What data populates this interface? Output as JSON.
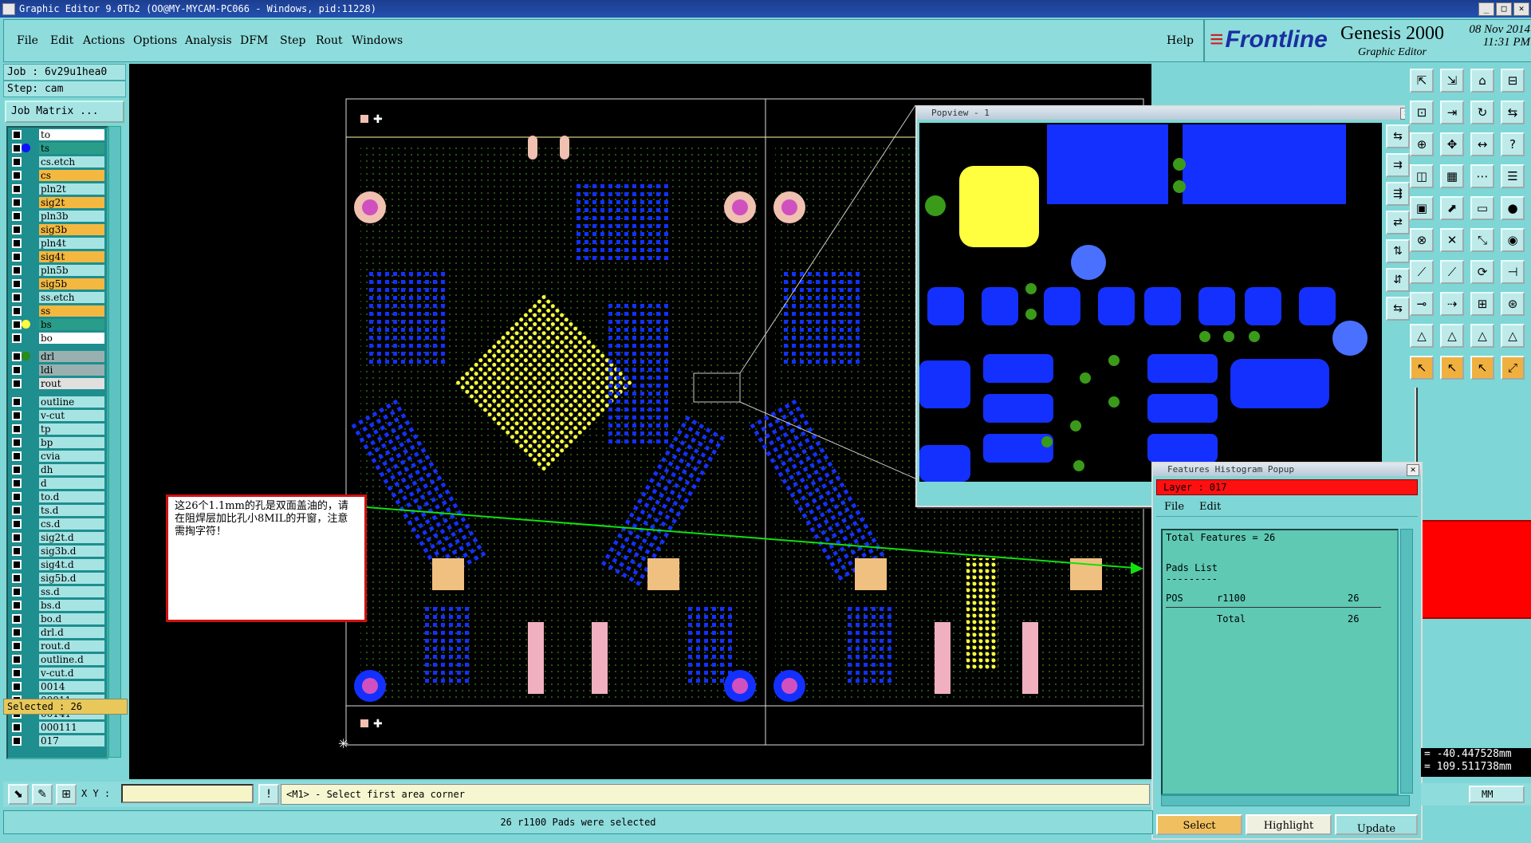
{
  "window": {
    "title": "Graphic Editor 9.0Tb2 (OO@MY-MYCAM-PC066 - Windows, pid:11228)",
    "controls": [
      "_",
      "□",
      "✕"
    ]
  },
  "menu": {
    "items": [
      "File",
      "Edit",
      "Actions",
      "Options",
      "Analysis",
      "DFM",
      "Step",
      "Rout",
      "Windows"
    ],
    "help": "Help"
  },
  "brand": {
    "logo": "Frontline",
    "product": "Genesis 2000",
    "subtitle": "Graphic Editor",
    "date": "08 Nov 2014",
    "time": "11:31 PM"
  },
  "job": {
    "job_label": "Job : 6v29u1hea0",
    "step_label": "Step: cam",
    "matrix_button": "Job Matrix ..."
  },
  "layers": [
    {
      "name": "to",
      "bg": "#ffffff",
      "dot": ""
    },
    {
      "name": "ts",
      "bg": "#2a9c8a",
      "dot": "#1010ff"
    },
    {
      "name": "cs.etch",
      "bg": "#a6e4e4",
      "dot": ""
    },
    {
      "name": "cs",
      "bg": "#f4b840",
      "dot": ""
    },
    {
      "name": "pln2t",
      "bg": "#a6e4e4",
      "dot": ""
    },
    {
      "name": "sig2t",
      "bg": "#f4b840",
      "dot": ""
    },
    {
      "name": "pln3b",
      "bg": "#a6e4e4",
      "dot": ""
    },
    {
      "name": "sig3b",
      "bg": "#f4b840",
      "dot": ""
    },
    {
      "name": "pln4t",
      "bg": "#a6e4e4",
      "dot": ""
    },
    {
      "name": "sig4t",
      "bg": "#f4b840",
      "dot": ""
    },
    {
      "name": "pln5b",
      "bg": "#a6e4e4",
      "dot": ""
    },
    {
      "name": "sig5b",
      "bg": "#f4b840",
      "dot": ""
    },
    {
      "name": "ss.etch",
      "bg": "#a6e4e4",
      "dot": ""
    },
    {
      "name": "ss",
      "bg": "#f4b840",
      "dot": ""
    },
    {
      "name": "bs",
      "bg": "#2a9c8a",
      "dot": "#ffff40"
    },
    {
      "name": "bo",
      "bg": "#ffffff",
      "dot": ""
    },
    {
      "name": "drl",
      "bg": "#9ab0b0",
      "dot": "#2a8a1a"
    },
    {
      "name": "ldi",
      "bg": "#9ab0b0",
      "dot": ""
    },
    {
      "name": "rout",
      "bg": "#e0e0e0",
      "dot": ""
    },
    {
      "name": "outline",
      "bg": "#a6e4e4",
      "dot": ""
    },
    {
      "name": "v-cut",
      "bg": "#a6e4e4",
      "dot": ""
    },
    {
      "name": "tp",
      "bg": "#a6e4e4",
      "dot": ""
    },
    {
      "name": "bp",
      "bg": "#a6e4e4",
      "dot": ""
    },
    {
      "name": "cvia",
      "bg": "#a6e4e4",
      "dot": ""
    },
    {
      "name": "dh",
      "bg": "#a6e4e4",
      "dot": ""
    },
    {
      "name": "d",
      "bg": "#a6e4e4",
      "dot": ""
    },
    {
      "name": "to.d",
      "bg": "#a6e4e4",
      "dot": ""
    },
    {
      "name": "ts.d",
      "bg": "#a6e4e4",
      "dot": ""
    },
    {
      "name": "cs.d",
      "bg": "#a6e4e4",
      "dot": ""
    },
    {
      "name": "sig2t.d",
      "bg": "#a6e4e4",
      "dot": ""
    },
    {
      "name": "sig3b.d",
      "bg": "#a6e4e4",
      "dot": ""
    },
    {
      "name": "sig4t.d",
      "bg": "#a6e4e4",
      "dot": ""
    },
    {
      "name": "sig5b.d",
      "bg": "#a6e4e4",
      "dot": ""
    },
    {
      "name": "ss.d",
      "bg": "#a6e4e4",
      "dot": ""
    },
    {
      "name": "bs.d",
      "bg": "#a6e4e4",
      "dot": ""
    },
    {
      "name": "bo.d",
      "bg": "#a6e4e4",
      "dot": ""
    },
    {
      "name": "drl.d",
      "bg": "#a6e4e4",
      "dot": ""
    },
    {
      "name": "rout.d",
      "bg": "#a6e4e4",
      "dot": ""
    },
    {
      "name": "outline.d",
      "bg": "#a6e4e4",
      "dot": ""
    },
    {
      "name": "v-cut.d",
      "bg": "#a6e4e4",
      "dot": ""
    },
    {
      "name": "0014",
      "bg": "#a6e4e4",
      "dot": ""
    },
    {
      "name": "00011",
      "bg": "#a6e4e4",
      "dot": ""
    },
    {
      "name": "00141",
      "bg": "#a6e4e4",
      "dot": ""
    },
    {
      "name": "000111",
      "bg": "#a6e4e4",
      "dot": ""
    },
    {
      "name": "017",
      "bg": "#a6e4e4",
      "dot": ""
    }
  ],
  "selected_count": "Selected : 26",
  "popview": {
    "title": "Popview - 1"
  },
  "histogram": {
    "title": "Features Histogram Popup",
    "layer": "Layer :  017",
    "menu": [
      "File",
      "Edit"
    ],
    "total_features": "Total Features = 26",
    "pads_list": "Pads List",
    "pads_underline": "---------",
    "row": {
      "type": "POS",
      "symbol": "r1100",
      "count": "26"
    },
    "total_label": "Total",
    "total_count": "26",
    "buttons": {
      "select": "Select",
      "highlight": "Highlight",
      "update": "Update"
    }
  },
  "note": {
    "text": "这26个1.1mm的孔是双面盖油的，请在阻焊层加比孔小8MIL的开窗，注意需掏字符！"
  },
  "command": {
    "xy_label": "X Y :",
    "xy_value": "",
    "prompt": "<M1> - Select first area corner"
  },
  "status": "26 r1100 Pads were selected",
  "coords": {
    "x": "= -40.447528mm",
    "y": "= 109.511738mm"
  },
  "units": "MM",
  "colors": {
    "board_blue": "#1430ff",
    "pad_yellow": "#ffff40",
    "pad_pink": "#e070e0",
    "trace_green": "#3a8a1a",
    "selection_arrow": "#10e010"
  }
}
